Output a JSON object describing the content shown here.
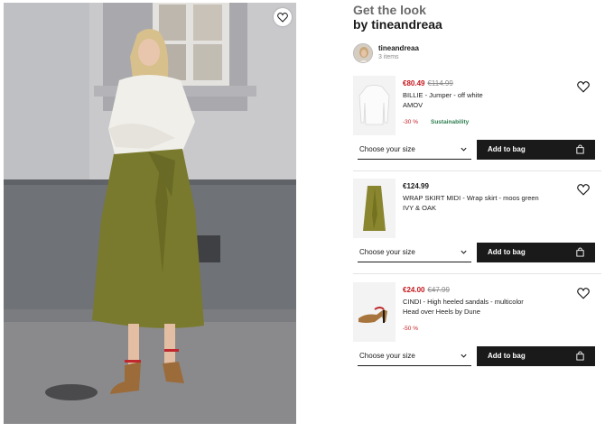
{
  "look": {
    "title_line1": "Get the look",
    "title_line2": "by tineandreaa"
  },
  "author": {
    "name": "tineandreaa",
    "item_count": "3 items"
  },
  "products": [
    {
      "price": "€80.49",
      "old_price": "€114.99",
      "name": "BILLIE - Jumper - off white",
      "brand": "AMOV",
      "discount": "-30 %",
      "tag": "Sustainability",
      "size_placeholder": "Choose your size",
      "add_label": "Add to bag"
    },
    {
      "price": "€124.99",
      "name": "WRAP SKIRT MIDI - Wrap skirt - moos green",
      "brand": "IVY & OAK",
      "size_placeholder": "Choose your size",
      "add_label": "Add to bag"
    },
    {
      "price": "€24.00",
      "old_price": "€47.99",
      "name": "CINDI - High heeled sandals - multicolor",
      "brand": "Head over Heels by Dune",
      "discount": "-50 %",
      "size_placeholder": "Choose your size",
      "add_label": "Add to bag"
    }
  ],
  "icons": {
    "favourite": "heart-icon",
    "select": "chevron-down-icon",
    "bag": "shopping-bag-icon"
  },
  "colors": {
    "sale_red": "#c5171d",
    "sustainability_green": "#2e7d4f",
    "button_black": "#1a1a1a",
    "skirt_green": "#7a7a2e"
  }
}
